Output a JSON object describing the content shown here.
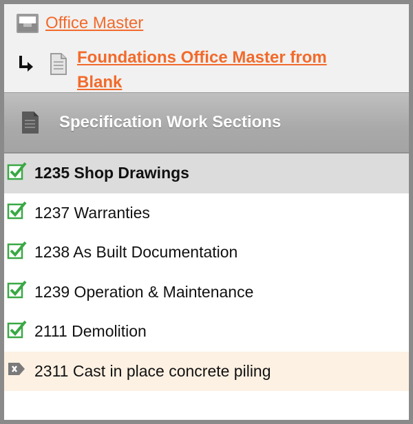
{
  "breadcrumb": {
    "level1": {
      "label": "Office Master",
      "icon": "tray-icon"
    },
    "level2": {
      "label": "Foundations Office Master from Blank",
      "icon": "document-icon"
    }
  },
  "section": {
    "title": "Specification Work Sections",
    "icon": "document-icon"
  },
  "colors": {
    "link": "#f26a2b",
    "check": "#3aa845",
    "selected_row": "#dcdcdc",
    "highlight_row": "#fdf1e3"
  },
  "work_sections": [
    {
      "label": "1235 Shop Drawings",
      "status": "checked",
      "state": "selected"
    },
    {
      "label": "1237 Warranties",
      "status": "checked",
      "state": "normal"
    },
    {
      "label": "1238 As Built Documentation",
      "status": "checked",
      "state": "normal"
    },
    {
      "label": "1239 Operation & Maintenance",
      "status": "checked",
      "state": "normal"
    },
    {
      "label": "2111 Demolition",
      "status": "checked",
      "state": "normal"
    },
    {
      "label": "2311 Cast in place concrete piling",
      "status": "removed",
      "state": "highlight"
    }
  ]
}
